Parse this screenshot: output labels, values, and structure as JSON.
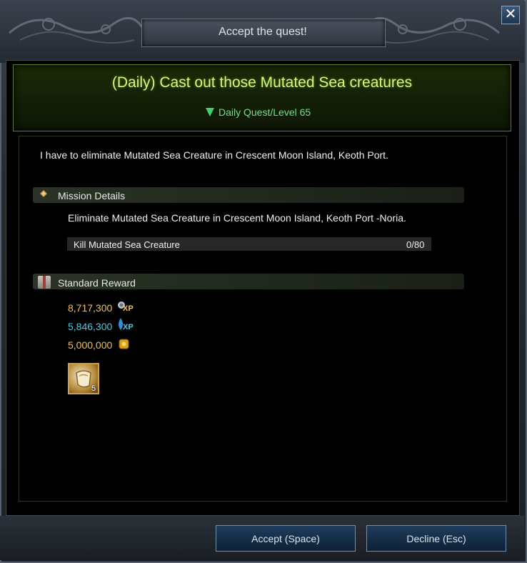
{
  "window": {
    "title": "Accept the quest!",
    "close_glyph": "✕"
  },
  "quest": {
    "title": "(Daily) Cast out those Mutated Sea creatures",
    "subtitle": "Daily Quest/Level 65",
    "description": "I have to eliminate Mutated Sea Creature in Crescent Moon Island, Keoth Port."
  },
  "mission": {
    "header": "Mission Details",
    "description": "Eliminate Mutated Sea Creature in Crescent Moon Island, Keoth Port -Noria.",
    "objectives": [
      {
        "label": "Kill Mutated Sea Creature",
        "count": "0/80"
      }
    ]
  },
  "rewards": {
    "header": "Standard Reward",
    "items": [
      {
        "value": "8,717,300",
        "tag": "XP",
        "icon": "skill-xp-icon",
        "color": "#f0c060"
      },
      {
        "value": "5,846,300",
        "tag": "XP",
        "icon": "contribution-xp-icon",
        "color": "#4ec8e0"
      },
      {
        "value": "5,000,000",
        "tag": "",
        "icon": "silver-coin-icon",
        "color": "#f0c060"
      }
    ],
    "item_slot": {
      "icon": "scroll-item-icon",
      "count": "5"
    }
  },
  "buttons": {
    "accept": "Accept (Space)",
    "decline": "Decline (Esc)"
  }
}
